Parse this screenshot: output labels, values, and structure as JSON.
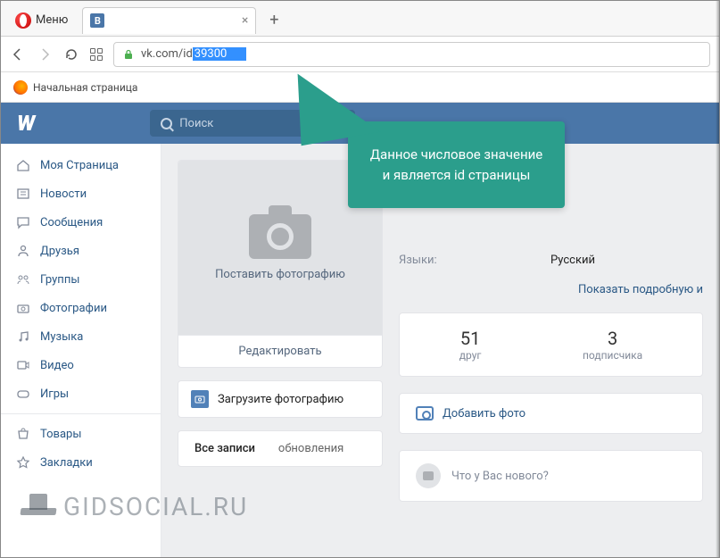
{
  "browser": {
    "menu_label": "Меню",
    "new_tab_tooltip": "Новая вкладка",
    "tab": {
      "favicon_text": "B",
      "title": ""
    },
    "url_prefix": "vk.com/id",
    "url_selected": "39300",
    "bookmark": "Начальная страница"
  },
  "vk": {
    "search_placeholder": "Поиск",
    "sidebar": {
      "items": [
        "Моя Страница",
        "Новости",
        "Сообщения",
        "Друзья",
        "Группы",
        "Фотографии",
        "Музыка",
        "Видео",
        "Игры"
      ],
      "items2": [
        "Товары",
        "Закладки"
      ]
    },
    "profile": {
      "put_photo": "Поставить фотографию",
      "edit": "Редактировать",
      "upload": "Загрузите фотографию",
      "tabs": {
        "all": "Все записи",
        "updates": "обновления"
      }
    },
    "info": {
      "languages_label": "Языки:",
      "languages_value": "Русский",
      "detail_link": "Показать подробную и"
    },
    "stats": {
      "friends_count": "51",
      "friends_label": "друг",
      "subs_count": "3",
      "subs_label": "подписчика"
    },
    "add_photo": "Добавить фото",
    "post_placeholder": "Что у Вас нового?"
  },
  "callout": "Данное числовое значение и является id страницы",
  "watermark": "GIDSOCIAL.RU"
}
